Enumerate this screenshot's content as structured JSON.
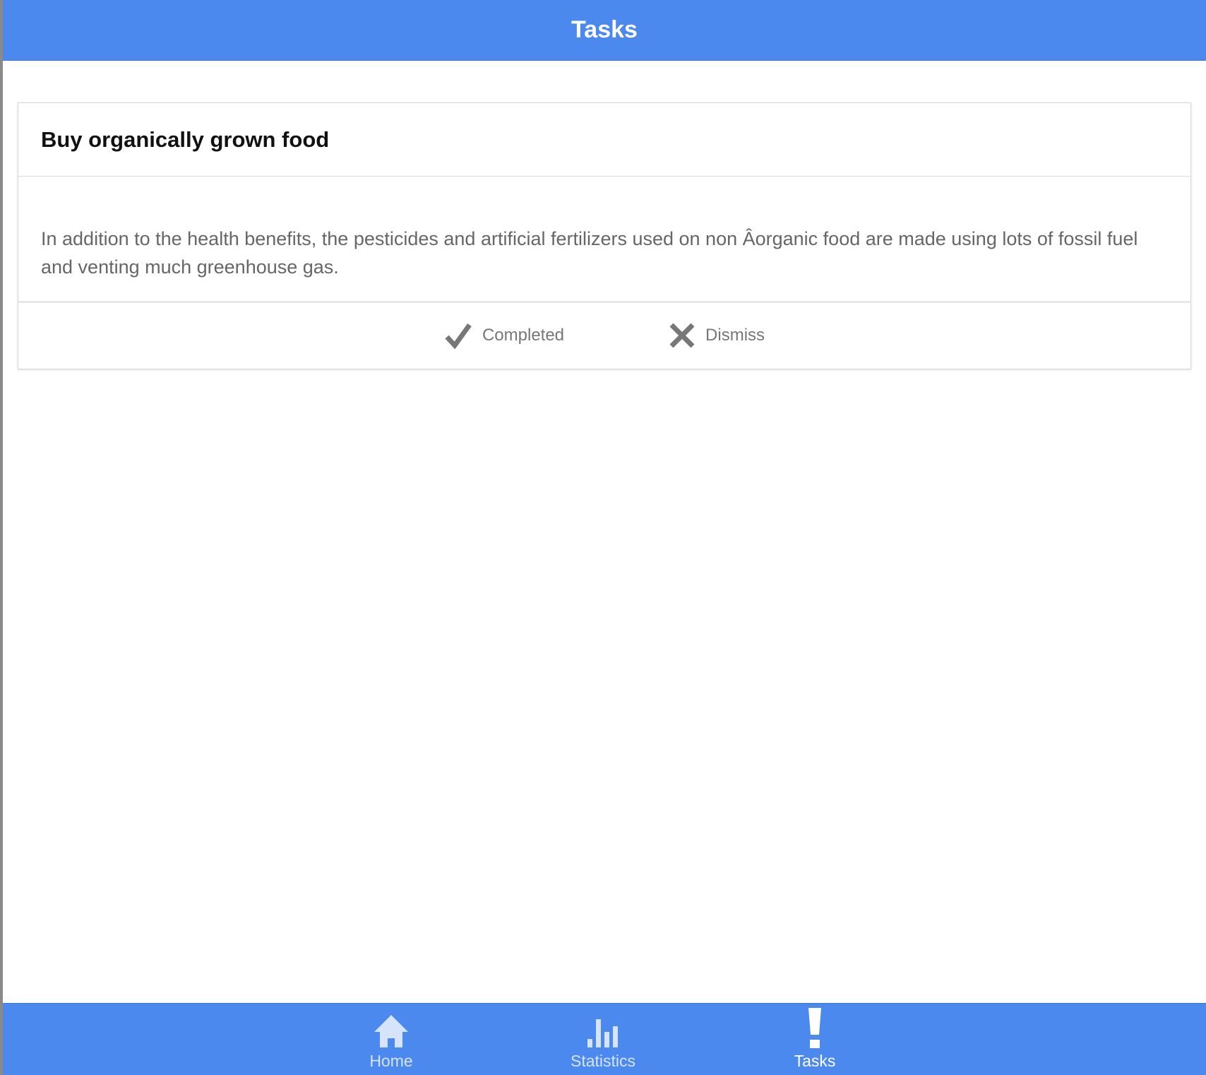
{
  "header": {
    "title": "Tasks"
  },
  "task_card": {
    "title": "Buy organically grown food",
    "description": "In addition to the health benefits, the pesticides and artificial fertilizers used on non Âorganic food are made using lots of fossil fuel and venting much greenhouse gas.",
    "actions": {
      "completed_label": "Completed",
      "completed_icon": "check-icon",
      "dismiss_label": "Dismiss",
      "dismiss_icon": "close-icon"
    }
  },
  "tabbar": {
    "tabs": [
      {
        "label": "Home",
        "icon": "home-icon",
        "active": false
      },
      {
        "label": "Statistics",
        "icon": "bar-chart-icon",
        "active": false
      },
      {
        "label": "Tasks",
        "icon": "exclamation-icon",
        "active": true
      }
    ]
  },
  "colors": {
    "accent": "#4b89ee",
    "inactive_tab": "#d6e4fb",
    "action_gray": "#777777"
  }
}
